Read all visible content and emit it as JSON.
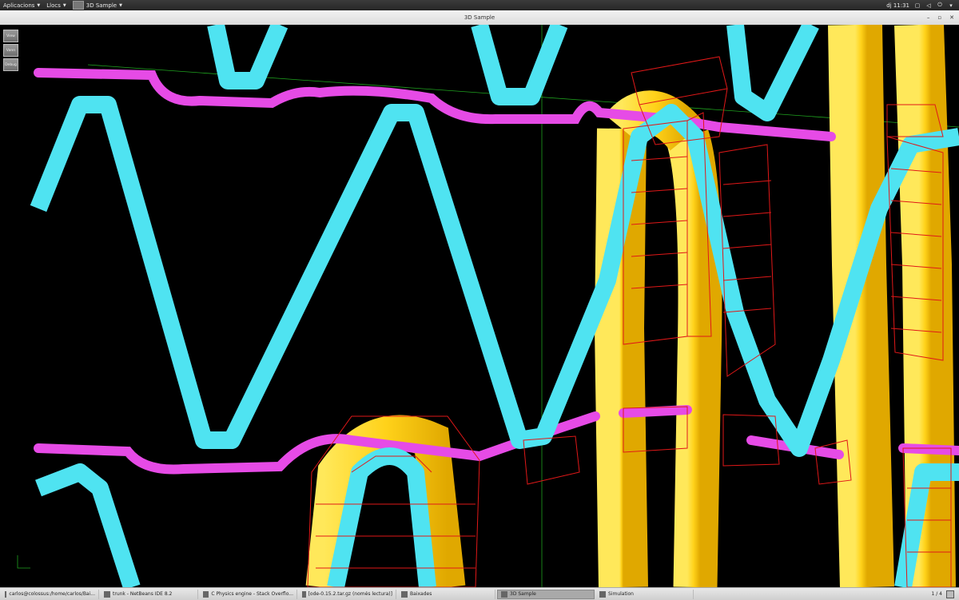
{
  "topbar": {
    "menus": [
      {
        "label": "Aplicacions"
      },
      {
        "label": "Llocs"
      },
      {
        "label": "3D Sample"
      }
    ],
    "clock": "dj 11:31"
  },
  "window": {
    "title": "3D Sample",
    "min_glyph": "–",
    "max_glyph": "▫",
    "close_glyph": "✕"
  },
  "side_buttons": [
    "View",
    "Vann",
    "Debug"
  ],
  "taskbar": {
    "tasks": [
      {
        "label": "carlos@colossus:/home/carlos/Bai...",
        "active": false
      },
      {
        "label": "trunk - NetBeans IDE 8.2",
        "active": false
      },
      {
        "label": "C Physics engine - Stack Overflo...",
        "active": false
      },
      {
        "label": "[ode-0.15.2.tar.gz (només lectura)]",
        "active": false
      },
      {
        "label": "Baixades",
        "active": false
      },
      {
        "label": "3D Sample",
        "active": true
      },
      {
        "label": "Simulation",
        "active": false
      }
    ],
    "pager": "1 / 4"
  },
  "colors": {
    "cyan": "#4fe3f1",
    "magenta": "#e64be6",
    "yellow": "#ffd21a",
    "wire": "#e01818",
    "axis": "#22aa22"
  }
}
